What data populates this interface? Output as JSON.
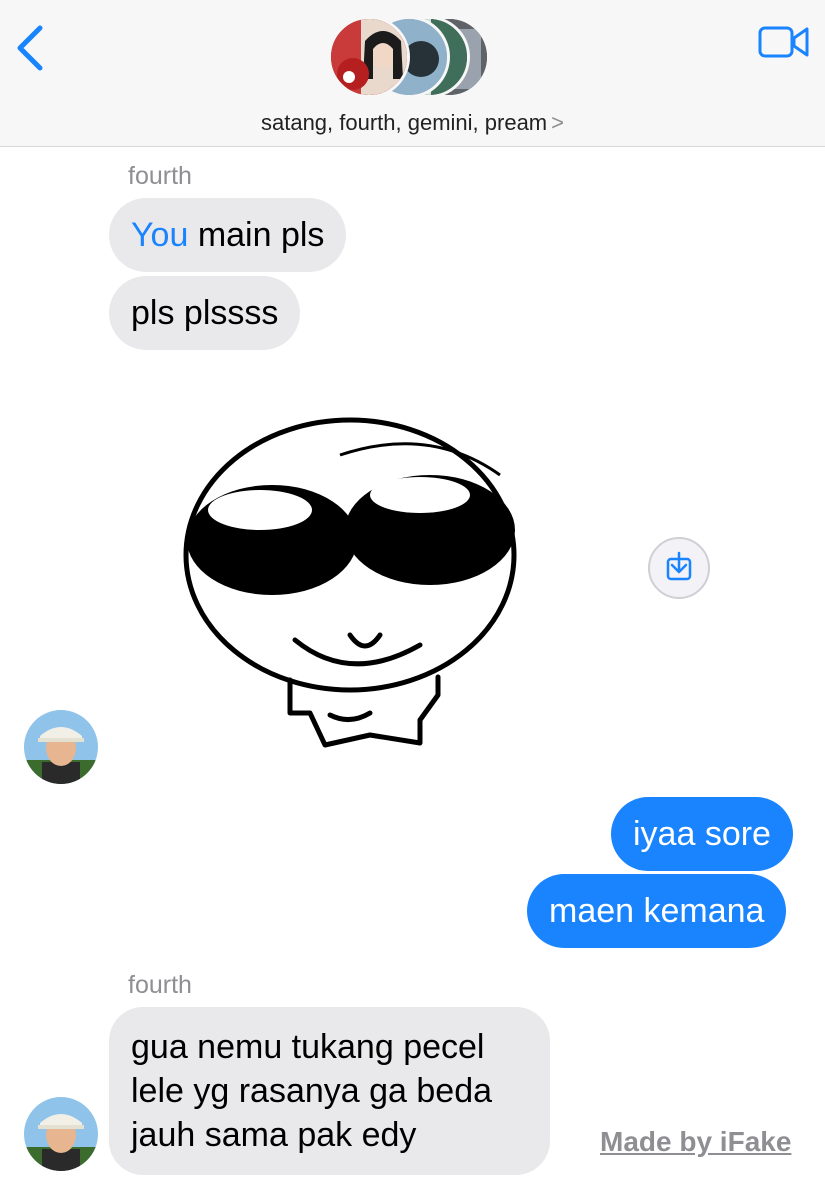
{
  "header": {
    "group_title": "satang, fourth, gemini, pream",
    "chevron": ">",
    "back_icon": "chevron-left-icon",
    "video_icon": "video-camera-icon",
    "accent_color": "#1a84ff"
  },
  "messages": [
    {
      "sender": "fourth"
    },
    {
      "mention": "You",
      "text": " main pls"
    },
    {
      "text": "pls plssss"
    },
    {
      "type": "sticker",
      "icon": "sunglasses-cartoon-sticker"
    },
    {
      "sent": "iyaa sore"
    },
    {
      "sent": "maen kemana"
    },
    {
      "sender": "fourth"
    },
    {
      "lines": [
        "gua nemu tukang pecel",
        "lele yg rasanya ga beda",
        "jauh sama pak edy"
      ]
    }
  ],
  "watermark": "Made by iFake"
}
